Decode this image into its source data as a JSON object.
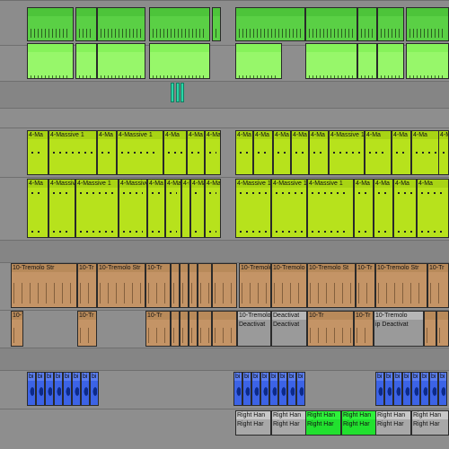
{
  "colors": {
    "synth_green": "#5ad045",
    "synth_light_green": "#97f76a",
    "massive_lime": "#b7e21c",
    "tremolo_brown": "#c49466",
    "deactivated_grey": "#9a9a9a",
    "drum_blue": "#3c63e6",
    "right_hand_bright_green": "#22e02f"
  },
  "tracks": {
    "massive_top": {
      "label": "4-Massive 1",
      "short": "4-Ma"
    },
    "massive_short": {
      "label": "4-Massive 1",
      "short": "4-Ma"
    },
    "tremolo": {
      "label": "10-Tremolo Str",
      "label_b": "10-Tremolo",
      "label_c": "10-Tremolo St",
      "label_d": "10-Tr"
    },
    "tremolo_deact": {
      "label": "Deactivat",
      "label_b": "Deactivat",
      "label_c": "ip Deactivat"
    },
    "drums": {
      "label": "bi"
    },
    "right_hand": {
      "label": "Right Han",
      "prefix": "Right Har"
    }
  }
}
